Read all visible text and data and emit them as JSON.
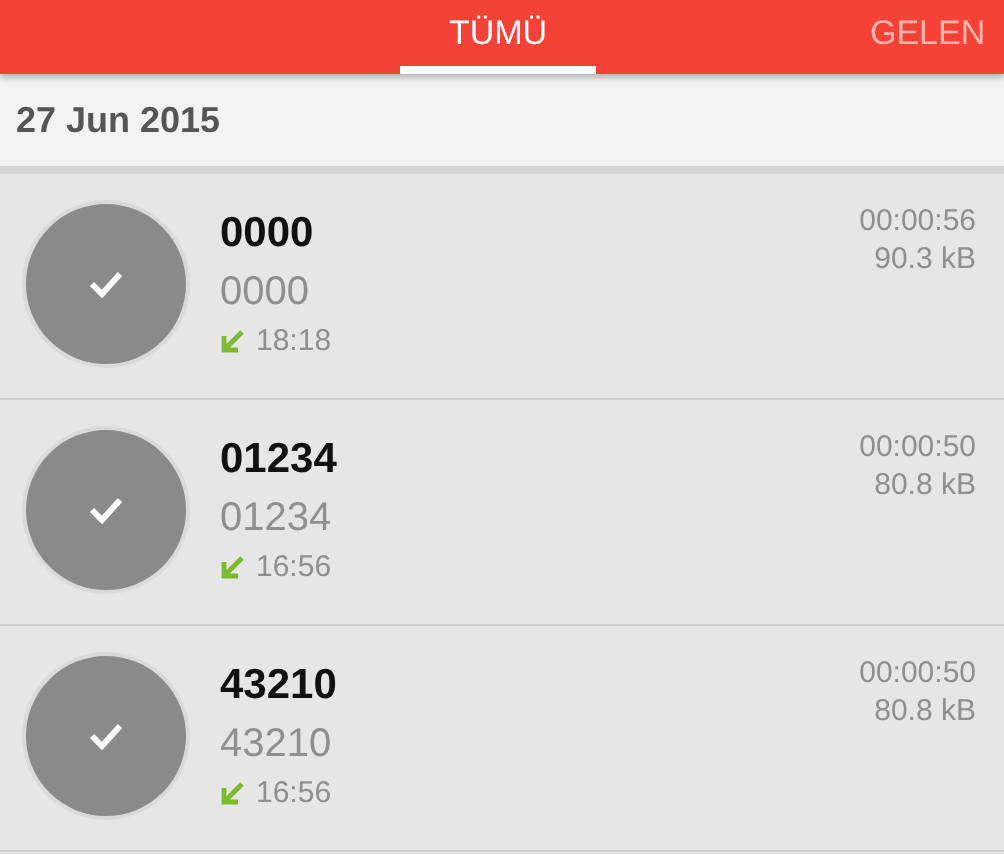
{
  "tabs": [
    {
      "label": "TÜMÜ",
      "selected": true
    },
    {
      "label": "GELEN",
      "selected": false
    }
  ],
  "date_header": "27 Jun 2015",
  "calls": [
    {
      "name": "0000",
      "number": "0000",
      "kind": "incoming",
      "time": "18:18",
      "duration": "00:00:56",
      "size": "90.3 kB",
      "checked": true
    },
    {
      "name": "01234",
      "number": "01234",
      "kind": "incoming",
      "time": "16:56",
      "duration": "00:00:50",
      "size": "80.8 kB",
      "checked": true
    },
    {
      "name": "43210",
      "number": "43210",
      "kind": "incoming",
      "time": "16:56",
      "duration": "00:00:50",
      "size": "80.8 kB",
      "checked": true
    }
  ]
}
